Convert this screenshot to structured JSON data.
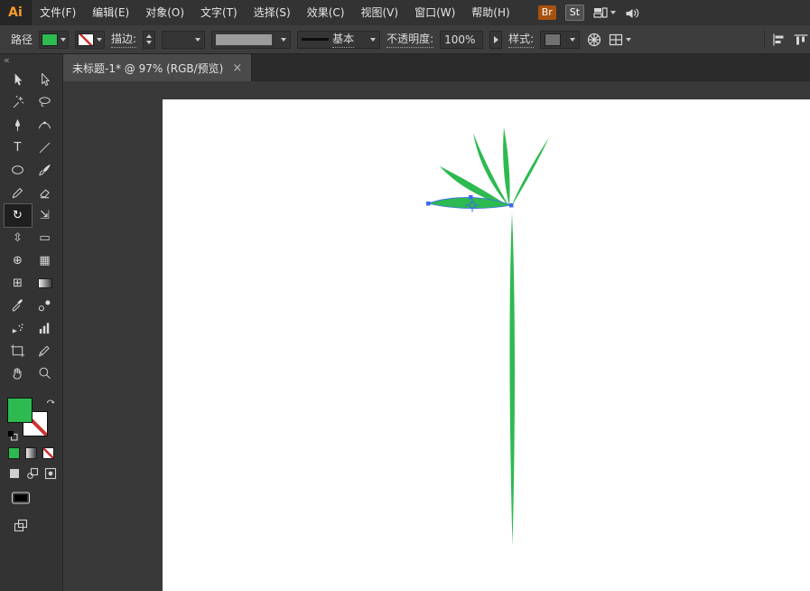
{
  "app": {
    "logo": "Ai",
    "menus": [
      "文件(F)",
      "编辑(E)",
      "对象(O)",
      "文字(T)",
      "选择(S)",
      "效果(C)",
      "视图(V)",
      "窗口(W)",
      "帮助(H)"
    ],
    "bridge_badge": "Br",
    "stock_badge": "St"
  },
  "control_bar": {
    "context_label": "路径",
    "stroke_label": "描边:",
    "brush_definition": "基本",
    "opacity_label": "不透明度:",
    "opacity_value": "100%",
    "style_label": "样式:"
  },
  "document_tab": {
    "title": "未标题-1* @ 97% (RGB/预览)",
    "name": "未标题-1*",
    "zoom": "97%",
    "color_mode": "RGB/预览",
    "close": "×"
  },
  "tools": {
    "selected": "rotate-tool",
    "collapse_glyph": "«",
    "names": [
      "selection-tool",
      "direct-selection-tool",
      "magic-wand-tool",
      "lasso-tool",
      "pen-tool",
      "curvature-tool",
      "type-tool",
      "line-segment-tool",
      "ellipse-tool",
      "paintbrush-tool",
      "pencil-tool",
      "eraser-tool",
      "rotate-tool",
      "scale-tool",
      "width-tool",
      "free-transform-tool",
      "shape-builder-tool",
      "perspective-grid-tool",
      "mesh-tool",
      "gradient-tool",
      "eyedropper-tool",
      "blend-tool",
      "symbol-sprayer-tool",
      "column-graph-tool",
      "artboard-tool",
      "slice-tool",
      "hand-tool",
      "zoom-tool"
    ],
    "glyphs": {
      "type": "T",
      "rotate": "↻",
      "scale": "⇲",
      "width": "⇳",
      "free_transform": "▭",
      "shape_builder": "⊕",
      "perspective_grid": "▦",
      "mesh": "⊞"
    }
  },
  "colors": {
    "artwork_green": "#2DBA50",
    "fill_swatch": "#2DBA50",
    "selection_blue": "#3E6BEF",
    "none_slash_red": "#D23030"
  }
}
